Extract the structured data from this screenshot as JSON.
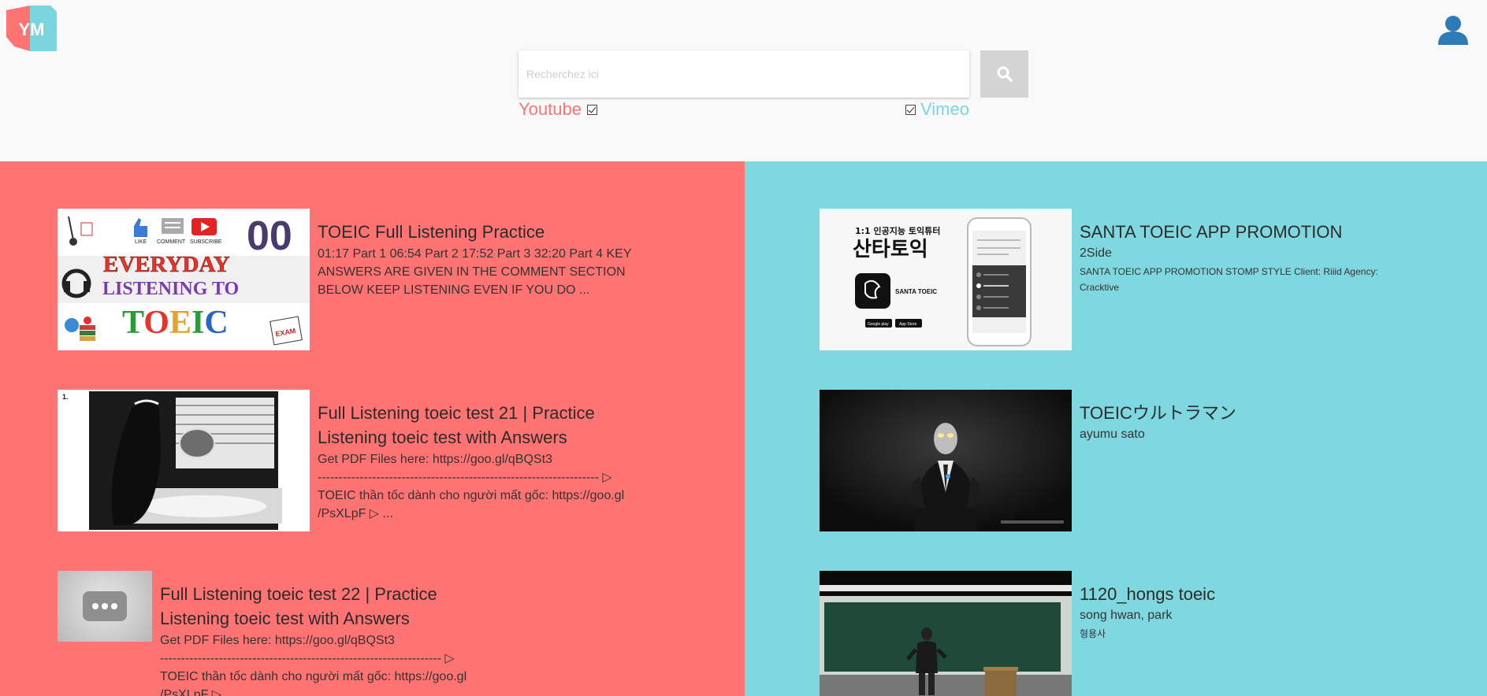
{
  "app": {
    "logo_text": "YM"
  },
  "search": {
    "placeholder": "Recherchez ici",
    "value": "",
    "sources": {
      "youtube_label": "Youtube",
      "youtube_checked": true,
      "vimeo_label": "Vimeo",
      "vimeo_checked": true
    }
  },
  "colors": {
    "youtube": "#ff7373",
    "vimeo": "#7fd8e0",
    "user_icon": "#2e7bb8"
  },
  "icons": {
    "user": "user-icon",
    "search": "search-icon",
    "more": "more-dots-icon"
  },
  "youtube_results": [
    {
      "title": "TOEIC Full Listening Practice",
      "description": "01:17 Part 1 06:54 Part 2 17:52 Part 3 32:20 Part 4 KEY ANSWERS ARE GIVEN IN THE COMMENT SECTION BELOW KEEP LISTENING EVEN IF YOU DO ...",
      "thumb_text": {
        "number": "00",
        "like": "LIKE",
        "comment": "COMMENT",
        "subscribe": "SUBSCRIBE",
        "line1": "EVERYDAY",
        "line2": "LISTENING TO",
        "line3": "TOEIC",
        "sticker": "EXAM"
      }
    },
    {
      "title": "Full Listening toeic test 21 | Practice Listening toeic test with Answers",
      "description_lines": [
        "Get PDF Files here: https://goo.gl/qBQSt3",
        "------------------------------------------------------------------- ▷",
        "TOEIC thần tốc dành cho người mất gốc: https://goo.gl /PsXLpF ▷ ..."
      ],
      "thumb_text": {
        "number": "1."
      }
    },
    {
      "title": "Full Listening toeic test 22 | Practice Listening toeic test with Answers",
      "description_lines": [
        "Get PDF Files here: https://goo.gl/qBQSt3",
        "------------------------------------------------------------------- ▷",
        "TOEIC thần tốc dành cho người mất gốc: https://goo.gl /PsXLpF ▷ ..."
      ]
    }
  ],
  "vimeo_results": [
    {
      "title": "SANTA TOEIC APP PROMOTION",
      "author": "2Side",
      "description": "SANTA TOEIC APP PROMOTION STOMP STYLE Client: Riiid Agency: Cracktive",
      "thumb_text": {
        "tagline": "1:1 인공지능 토익튜터",
        "brand": "산타토익",
        "app_name": "SANTA TOEIC",
        "store1": "Google play",
        "store2": "App Store"
      }
    },
    {
      "title": "TOEICウルトラマン",
      "author": "ayumu sato",
      "description": ""
    },
    {
      "title": "1120_hongs toeic",
      "author": "song hwan, park",
      "description": "형용사"
    }
  ]
}
